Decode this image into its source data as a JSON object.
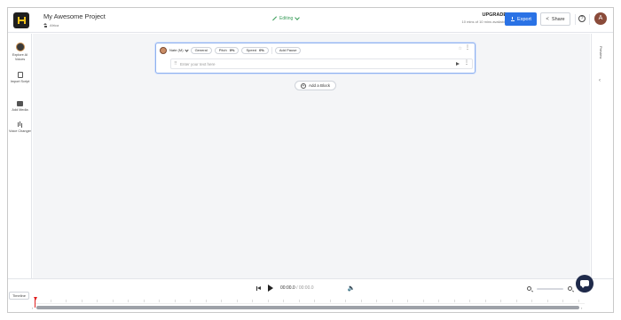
{
  "header": {
    "project_title": "My Awesome Project",
    "breadcrumb": "Africa",
    "status": "Editing",
    "upgrade": {
      "title": "UPGRADE",
      "subtitle": "10 mins of 10 mins available"
    },
    "export_label": "Export",
    "share_label": "Share",
    "help": "?",
    "avatar_initial": "A"
  },
  "sidebar": {
    "items": [
      {
        "label": "Explore AI Voices",
        "icon": "voice-avatar-icon"
      },
      {
        "label": "Import Script",
        "icon": "document-icon"
      },
      {
        "label": "Add Media",
        "icon": "media-icon"
      },
      {
        "label": "Voice Changer",
        "icon": "waveform-icon"
      }
    ]
  },
  "block": {
    "voice_name": "Nate (M)",
    "style": "General",
    "pitch_label": "Pitch",
    "pitch_value": "0%",
    "speed_label": "Speed",
    "speed_value": "0%",
    "add_pause_label": "Add Pause",
    "text_placeholder": "Enter your text here"
  },
  "add_block_label": "Add a Block",
  "preview_label": "Preview",
  "player": {
    "current_time": "00:00.0",
    "total_time": "00:00.0"
  },
  "timeline_label": "Timeline",
  "colors": {
    "accent": "#2a72e5",
    "editing": "#3a9d5a",
    "playhead": "#e02020"
  }
}
